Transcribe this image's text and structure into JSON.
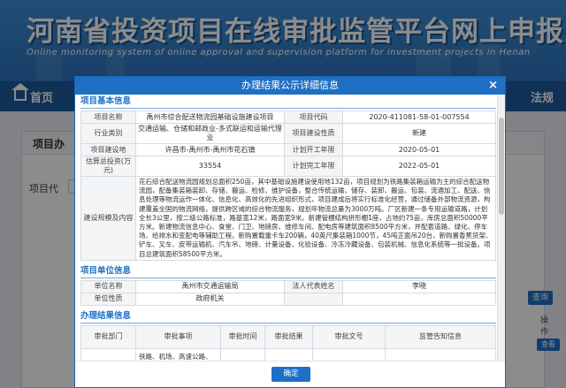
{
  "site": {
    "title": "河南省投资项目在线审批监管平台网上申报系统",
    "subtitle": "Online monitoring system of online approval and supervision platform for investment projects in Henan"
  },
  "nav": {
    "first_label": "首页",
    "last_label": "法规"
  },
  "background": {
    "panel_title": "项目办",
    "left_label": "项目代",
    "query_label": "查询",
    "op_header": "操作",
    "view_label": "查看"
  },
  "modal": {
    "title": "办理结果公示详细信息",
    "close_label": "×",
    "ok_label": "确定",
    "basic_section": {
      "title": "项目基本信息",
      "labels": {
        "project_name": "项目名称",
        "project_code": "项目代码",
        "industry": "行业类别",
        "nature": "项目建设性质",
        "location": "项目建设地",
        "start": "计划开工年限",
        "investment": "估算总投资(万元)",
        "finish": "计划完工年限",
        "scale": "建设规模及内容"
      },
      "values": {
        "project_name": "禹州市综合配送物流园基础设施建设项目",
        "project_code": "2020-411081-58-01-007554",
        "industry": "交通运输、仓储和邮政业-多式联运和运输代理业",
        "nature": "新建",
        "location": "许昌市-禹州市-禹州市花石镇",
        "start": "2020-05-01",
        "investment": "33554",
        "finish": "2022-05-01",
        "scale": "花石综合配送物流园规划总面积250亩，其中基础设施建设使用地132亩，项目规划为铁路集装箱运输为主的综合配送物流园，配备集装箱装卸、存储、搬运、检修、维护设备，整合传统运输、储存、装卸、搬运、包装、流通加工、配送、信息处理等物流运作一体化、信息化、高效化的先进组织形式，项目建成后将实行标准化经营，通过储备外部物流资源，构建覆盖全国的物流网络，提供跨区域的综合物流服务，规划年物流总量为3000万吨。厂区新建一条专用运输道路，计划全长3公里，按二级公路标准，路基宽12米，路面宽9米。新建管棚结构拼形棚1座，占地约75亩，库房总面积50000平方米。新建物流信息中心、食堂、门卫、地磅房、维修车间、配电房等建筑面积8500平方米，并配套道路、绿化、停车场、给排水和变配电等辅助工程。新购置载重卡车200辆，40英尺集装箱1000节，45吨正面吊20台，新购置香蕉货架、铲车、叉车、皮带运输机、汽车吊、地磅、计量设备、化验设备、冷冻冷藏设备、包装机械、信息化系统等一批设备。项目总建筑面积58500平方米。"
      }
    },
    "unit_section": {
      "title": "项目单位信息",
      "labels": {
        "unit_name": "单位名称",
        "legal_rep": "法人代表姓名",
        "unit_nature": "单位性质"
      },
      "values": {
        "unit_name": "禹州市交通运输局",
        "legal_rep": "李晓",
        "unit_nature": "政府机关"
      }
    },
    "result_section": {
      "title": "办理结果信息",
      "headers": [
        "审批部门",
        "审批事项",
        "审批时间",
        "审批结果",
        "审批文号",
        "监管告知信息"
      ],
      "row_item": "铁路、机场、高速公路、普通国省道、农村公路、内河航道、独立公（铁）"
    }
  }
}
